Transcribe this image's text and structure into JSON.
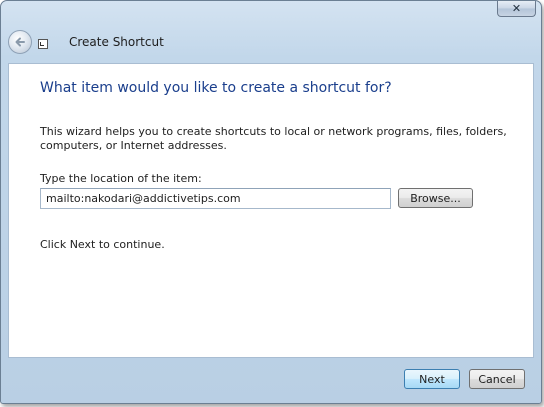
{
  "window": {
    "close_label": "✕",
    "title": "Create Shortcut"
  },
  "wizard": {
    "heading": "What item would you like to create a shortcut for?",
    "description": "This wizard helps you to create shortcuts to local or network programs, files, folders, computers, or Internet addresses.",
    "field_label": "Type the location of the item:",
    "location_value": "mailto:nakodari@addictivetips.com",
    "browse_label": "Browse...",
    "continue_text": "Click Next to continue."
  },
  "footer": {
    "next_label": "Next",
    "cancel_label": "Cancel"
  },
  "icons": {
    "back": "back-arrow-icon",
    "title": "shortcut-wizard-icon",
    "close": "close-icon"
  }
}
